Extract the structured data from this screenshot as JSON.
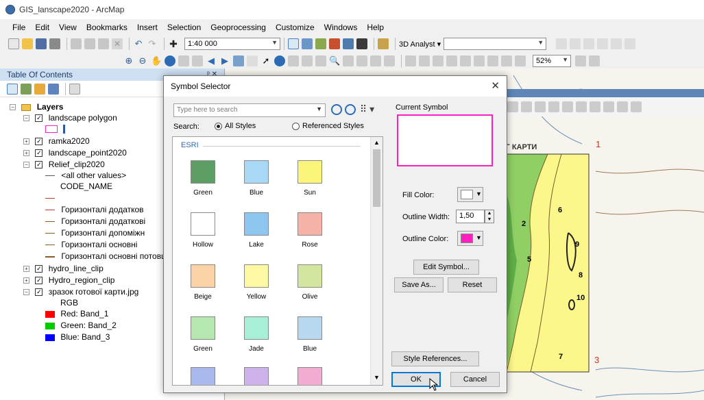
{
  "window": {
    "title": "GIS_lanscape2020 - ArcMap"
  },
  "menu": [
    "File",
    "Edit",
    "View",
    "Bookmarks",
    "Insert",
    "Selection",
    "Geoprocessing",
    "Customize",
    "Windows",
    "Help"
  ],
  "toolbar": {
    "scale_value": "1:40 000",
    "analyst_label": "3D Analyst ▾",
    "zoom_value": "52%"
  },
  "toc": {
    "title": "Table Of Contents",
    "pin": "ᵖ ✕",
    "root": "Layers",
    "items": [
      {
        "label": "landscape polygon"
      },
      {
        "label": "ramka2020"
      },
      {
        "label": "landscape_point2020"
      },
      {
        "label": "Relief_clip2020"
      },
      {
        "label": "<all other values>"
      },
      {
        "label": "CODE_NAME"
      },
      {
        "label": "Горизонталі додатков"
      },
      {
        "label": "Горизонталі додаткові"
      },
      {
        "label": "Горизонталі допоміжн"
      },
      {
        "label": "Горизонталі основні"
      },
      {
        "label": "Горизонталі основні потовщ"
      },
      {
        "label": "hydro_line_clip"
      },
      {
        "label": "Hydro_region_clip"
      },
      {
        "label": "зразок готової карти.jpg"
      },
      {
        "label": "RGB"
      },
      {
        "label": "Red:   Band_1"
      },
      {
        "label": "Green:  Band_2"
      },
      {
        "label": "Blue:   Band_3"
      }
    ]
  },
  "map": {
    "title_text": "ОГ КАРТИ",
    "labels": [
      "1",
      "2",
      "3",
      "5",
      "6",
      "7",
      "8",
      "9",
      "10"
    ]
  },
  "dialog": {
    "title": "Symbol Selector",
    "close": "✕",
    "search_placeholder": "Type here to search",
    "search_label": "Search:",
    "all_styles": "All Styles",
    "referenced_styles": "Referenced Styles",
    "group": "ESRI",
    "symbols": [
      "Green",
      "Blue",
      "Sun",
      "Hollow",
      "Lake",
      "Rose",
      "Beige",
      "Yellow",
      "Olive",
      "Green",
      "Jade",
      "Blue"
    ],
    "current_symbol": "Current Symbol",
    "fill_color": "Fill Color:",
    "outline_width": "Outline Width:",
    "outline_width_value": "1,50",
    "outline_color": "Outline Color:",
    "edit_symbol": "Edit Symbol...",
    "save_as": "Save As...",
    "reset": "Reset",
    "style_references": "Style References...",
    "ok": "OK",
    "cancel": "Cancel"
  },
  "colors": {
    "symbol_fills": [
      "#5c9e64",
      "#a8d8f5",
      "#fbf57a",
      "#ffffff",
      "#8fc6ef",
      "#f6b2a6",
      "#fbd3a7",
      "#fdf8a4",
      "#d3e6a0",
      "#b7e7b0",
      "#a7efd7",
      "#b7d8ef",
      "#a9b9ee",
      "#cdb2ec",
      "#f1acd1"
    ],
    "current_symbol_outline": "#ff1fbf",
    "outline_color": "#ff1fbf",
    "legend_red": "#ff0000",
    "legend_green": "#00cc00",
    "legend_blue": "#0000ff"
  }
}
